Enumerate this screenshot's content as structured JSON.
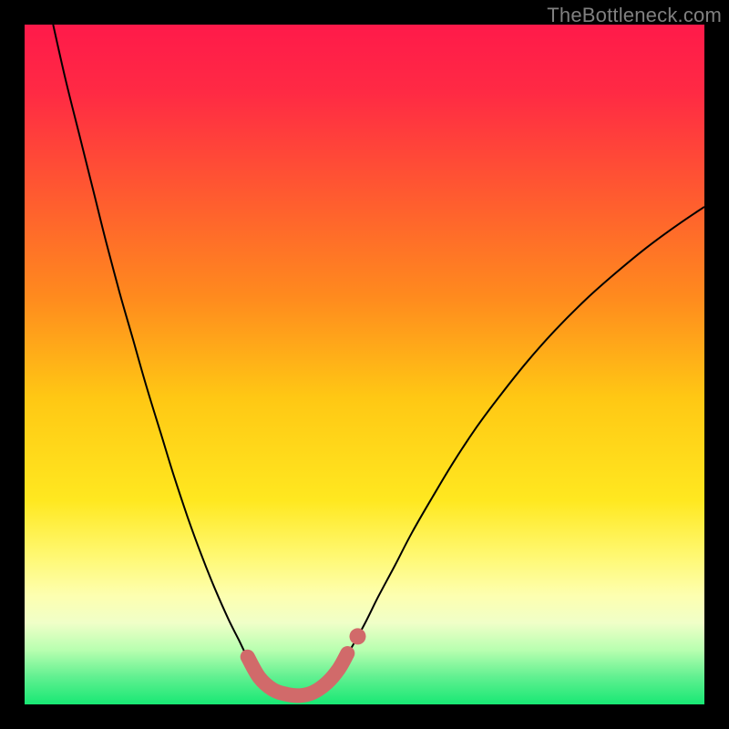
{
  "watermark": "TheBottleneck.com",
  "chart_data": {
    "type": "line",
    "title": "",
    "xlabel": "",
    "ylabel": "",
    "xlim": [
      0,
      1
    ],
    "ylim": [
      0,
      1
    ],
    "background_gradient": {
      "stops": [
        {
          "offset": 0.0,
          "color": "#ff1a4a"
        },
        {
          "offset": 0.1,
          "color": "#ff2a44"
        },
        {
          "offset": 0.25,
          "color": "#ff5a30"
        },
        {
          "offset": 0.4,
          "color": "#ff8a1e"
        },
        {
          "offset": 0.55,
          "color": "#ffc814"
        },
        {
          "offset": 0.7,
          "color": "#ffe820"
        },
        {
          "offset": 0.78,
          "color": "#fff870"
        },
        {
          "offset": 0.84,
          "color": "#fdffb0"
        },
        {
          "offset": 0.88,
          "color": "#f0ffc8"
        },
        {
          "offset": 0.92,
          "color": "#b8ffb0"
        },
        {
          "offset": 0.96,
          "color": "#60f090"
        },
        {
          "offset": 1.0,
          "color": "#18e874"
        }
      ]
    },
    "series": [
      {
        "name": "bottleneck-curve",
        "stroke": "#000000",
        "stroke_width": 2,
        "points": [
          {
            "x": 0.042,
            "y": 1.0
          },
          {
            "x": 0.06,
            "y": 0.92
          },
          {
            "x": 0.08,
            "y": 0.84
          },
          {
            "x": 0.1,
            "y": 0.76
          },
          {
            "x": 0.12,
            "y": 0.68
          },
          {
            "x": 0.14,
            "y": 0.605
          },
          {
            "x": 0.16,
            "y": 0.535
          },
          {
            "x": 0.18,
            "y": 0.465
          },
          {
            "x": 0.2,
            "y": 0.4
          },
          {
            "x": 0.22,
            "y": 0.335
          },
          {
            "x": 0.24,
            "y": 0.275
          },
          {
            "x": 0.26,
            "y": 0.22
          },
          {
            "x": 0.28,
            "y": 0.17
          },
          {
            "x": 0.3,
            "y": 0.125
          },
          {
            "x": 0.315,
            "y": 0.095
          },
          {
            "x": 0.33,
            "y": 0.065
          },
          {
            "x": 0.345,
            "y": 0.045
          },
          {
            "x": 0.36,
            "y": 0.03
          },
          {
            "x": 0.375,
            "y": 0.02
          },
          {
            "x": 0.39,
            "y": 0.014
          },
          {
            "x": 0.405,
            "y": 0.012
          },
          {
            "x": 0.42,
            "y": 0.015
          },
          {
            "x": 0.435,
            "y": 0.024
          },
          {
            "x": 0.45,
            "y": 0.038
          },
          {
            "x": 0.465,
            "y": 0.058
          },
          {
            "x": 0.48,
            "y": 0.082
          },
          {
            "x": 0.5,
            "y": 0.118
          },
          {
            "x": 0.52,
            "y": 0.158
          },
          {
            "x": 0.545,
            "y": 0.205
          },
          {
            "x": 0.57,
            "y": 0.253
          },
          {
            "x": 0.6,
            "y": 0.305
          },
          {
            "x": 0.63,
            "y": 0.355
          },
          {
            "x": 0.665,
            "y": 0.408
          },
          {
            "x": 0.7,
            "y": 0.455
          },
          {
            "x": 0.74,
            "y": 0.505
          },
          {
            "x": 0.78,
            "y": 0.55
          },
          {
            "x": 0.825,
            "y": 0.595
          },
          {
            "x": 0.87,
            "y": 0.635
          },
          {
            "x": 0.915,
            "y": 0.672
          },
          {
            "x": 0.96,
            "y": 0.705
          },
          {
            "x": 1.0,
            "y": 0.732
          }
        ]
      },
      {
        "name": "highlight-bottom",
        "stroke": "#d16a6a",
        "stroke_width": 16,
        "linecap": "round",
        "points": [
          {
            "x": 0.328,
            "y": 0.07
          },
          {
            "x": 0.345,
            "y": 0.04
          },
          {
            "x": 0.365,
            "y": 0.022
          },
          {
            "x": 0.385,
            "y": 0.015
          },
          {
            "x": 0.405,
            "y": 0.013
          },
          {
            "x": 0.425,
            "y": 0.018
          },
          {
            "x": 0.445,
            "y": 0.032
          },
          {
            "x": 0.462,
            "y": 0.052
          },
          {
            "x": 0.475,
            "y": 0.075
          }
        ],
        "extra_dot": {
          "x": 0.49,
          "y": 0.1,
          "r": 9
        }
      }
    ]
  }
}
